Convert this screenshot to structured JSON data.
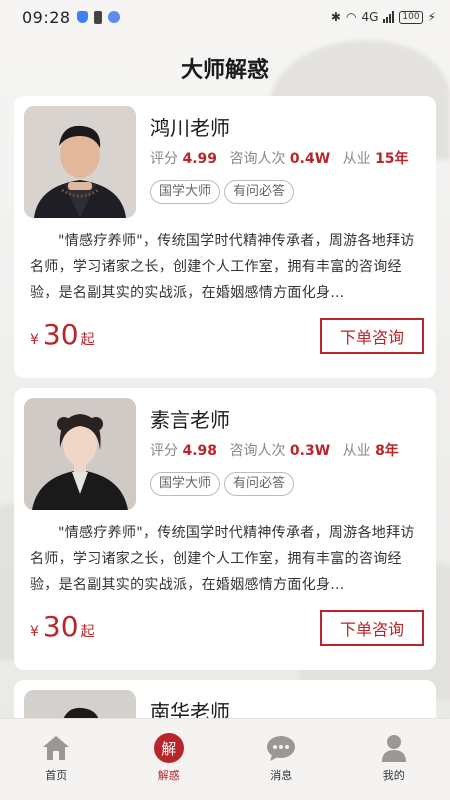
{
  "status_bar": {
    "time": "09:28",
    "network": "4G",
    "battery": "100"
  },
  "page": {
    "title": "大师解惑"
  },
  "masters": [
    {
      "name": "鸿川老师",
      "rating_label": "评分",
      "rating": "4.99",
      "consult_label": "咨询人次",
      "consult_count": "0.4W",
      "years_label": "从业",
      "years": "15年",
      "tags": [
        "国学大师",
        "有问必答"
      ],
      "description": "\"情感疗养师\"，传统国学时代精神传承者，周游各地拜访名师，学习诸家之长，创建个人工作室，拥有丰富的咨询经验，是名副其实的实战派，在婚姻感情方面化身…",
      "currency": "¥",
      "price": "30",
      "price_suffix": "起",
      "button": "下单咨询"
    },
    {
      "name": "素言老师",
      "rating_label": "评分",
      "rating": "4.98",
      "consult_label": "咨询人次",
      "consult_count": "0.3W",
      "years_label": "从业",
      "years": "8年",
      "tags": [
        "国学大师",
        "有问必答"
      ],
      "description": "\"情感疗养师\"，传统国学时代精神传承者，周游各地拜访名师，学习诸家之长，创建个人工作室，拥有丰富的咨询经验，是名副其实的实战派，在婚姻感情方面化身…",
      "currency": "¥",
      "price": "30",
      "price_suffix": "起",
      "button": "下单咨询"
    },
    {
      "name": "南华老师"
    }
  ],
  "tabbar": {
    "items": [
      {
        "label": "首页",
        "icon": "home-icon"
      },
      {
        "label": "解惑",
        "icon": "jie-icon",
        "glyph": "解"
      },
      {
        "label": "消息",
        "icon": "message-icon"
      },
      {
        "label": "我的",
        "icon": "user-icon"
      }
    ],
    "active": 1
  },
  "colors": {
    "accent": "#b8262b",
    "background": "#f1f0ee",
    "card": "#ffffff"
  }
}
